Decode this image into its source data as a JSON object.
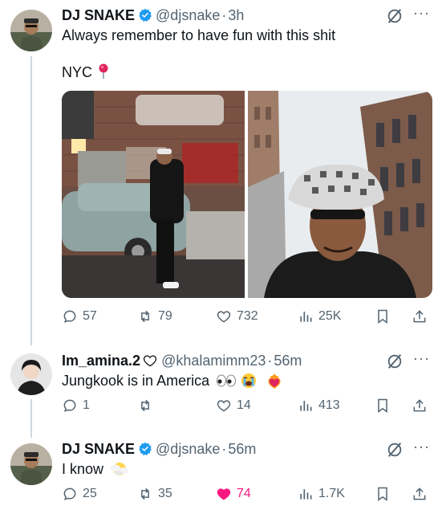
{
  "posts": [
    {
      "author_name": "DJ SNAKE",
      "handle": "@djsnake",
      "time_sep": "·",
      "time": "3h",
      "text_line1": "Always remember to have fun with this shit",
      "text_line2": "NYC",
      "location_icon": "round-pushpin-icon",
      "replies": "57",
      "reposts": "79",
      "likes": "732",
      "views": "25K"
    },
    {
      "author_name": "Im_amina.2",
      "handle": "@khalamimm23",
      "time_sep": "·",
      "time": "56m",
      "text": "Jungkook is in America",
      "emojis": [
        "eyes-icon",
        "loudly-crying-face-icon",
        "heart-on-fire-icon"
      ],
      "replies": "1",
      "reposts": "",
      "likes": "14",
      "views": "413"
    },
    {
      "author_name": "DJ SNAKE",
      "handle": "@djsnake",
      "time_sep": "·",
      "time": "56m",
      "text": "I know",
      "emoji": "face-in-clouds-icon",
      "replies": "25",
      "reposts": "35",
      "likes": "74",
      "liked": true,
      "views": "1.7K"
    }
  ],
  "colors": {
    "verified": "#1d9bf0",
    "like_active": "#f91880",
    "muted": "#536471"
  }
}
